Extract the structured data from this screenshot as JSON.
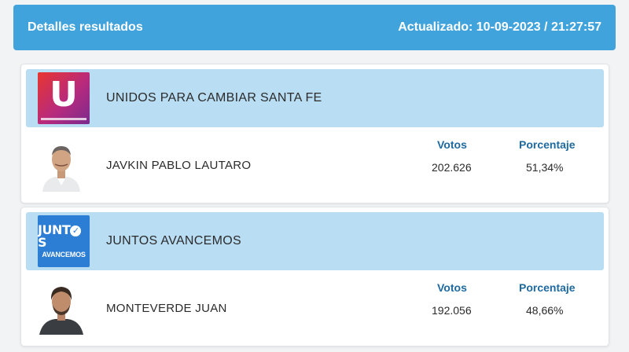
{
  "header": {
    "title": "Detalles resultados",
    "updated": "Actualizado: 10-09-2023 / 21:27:57"
  },
  "results": [
    {
      "party": {
        "name": "UNIDOS PARA CAMBIAR SANTA FE",
        "logo_text": "U",
        "logo_colors": [
          "#e9362f",
          "#b72a7d",
          "#7a2a8f"
        ]
      },
      "candidate": {
        "name": "JAVKIN PABLO LAUTARO",
        "votes_label": "Votos",
        "votes": "202.626",
        "percent_label": "Porcentaje",
        "percent": "51,34%"
      }
    },
    {
      "party": {
        "name": "JUNTOS AVANCEMOS",
        "logo_line1": "JUNT",
        "logo_line1_end": "S",
        "logo_line2": "AVANCEMOS",
        "logo_color": "#2c7dd4"
      },
      "candidate": {
        "name": "MONTEVERDE JUAN",
        "votes_label": "Votos",
        "votes": "192.056",
        "percent_label": "Porcentaje",
        "percent": "48,66%"
      }
    }
  ],
  "colors": {
    "header_bg": "#41a3dc",
    "party_bg": "#b9ddf3",
    "column_header": "#1e6aa0"
  }
}
